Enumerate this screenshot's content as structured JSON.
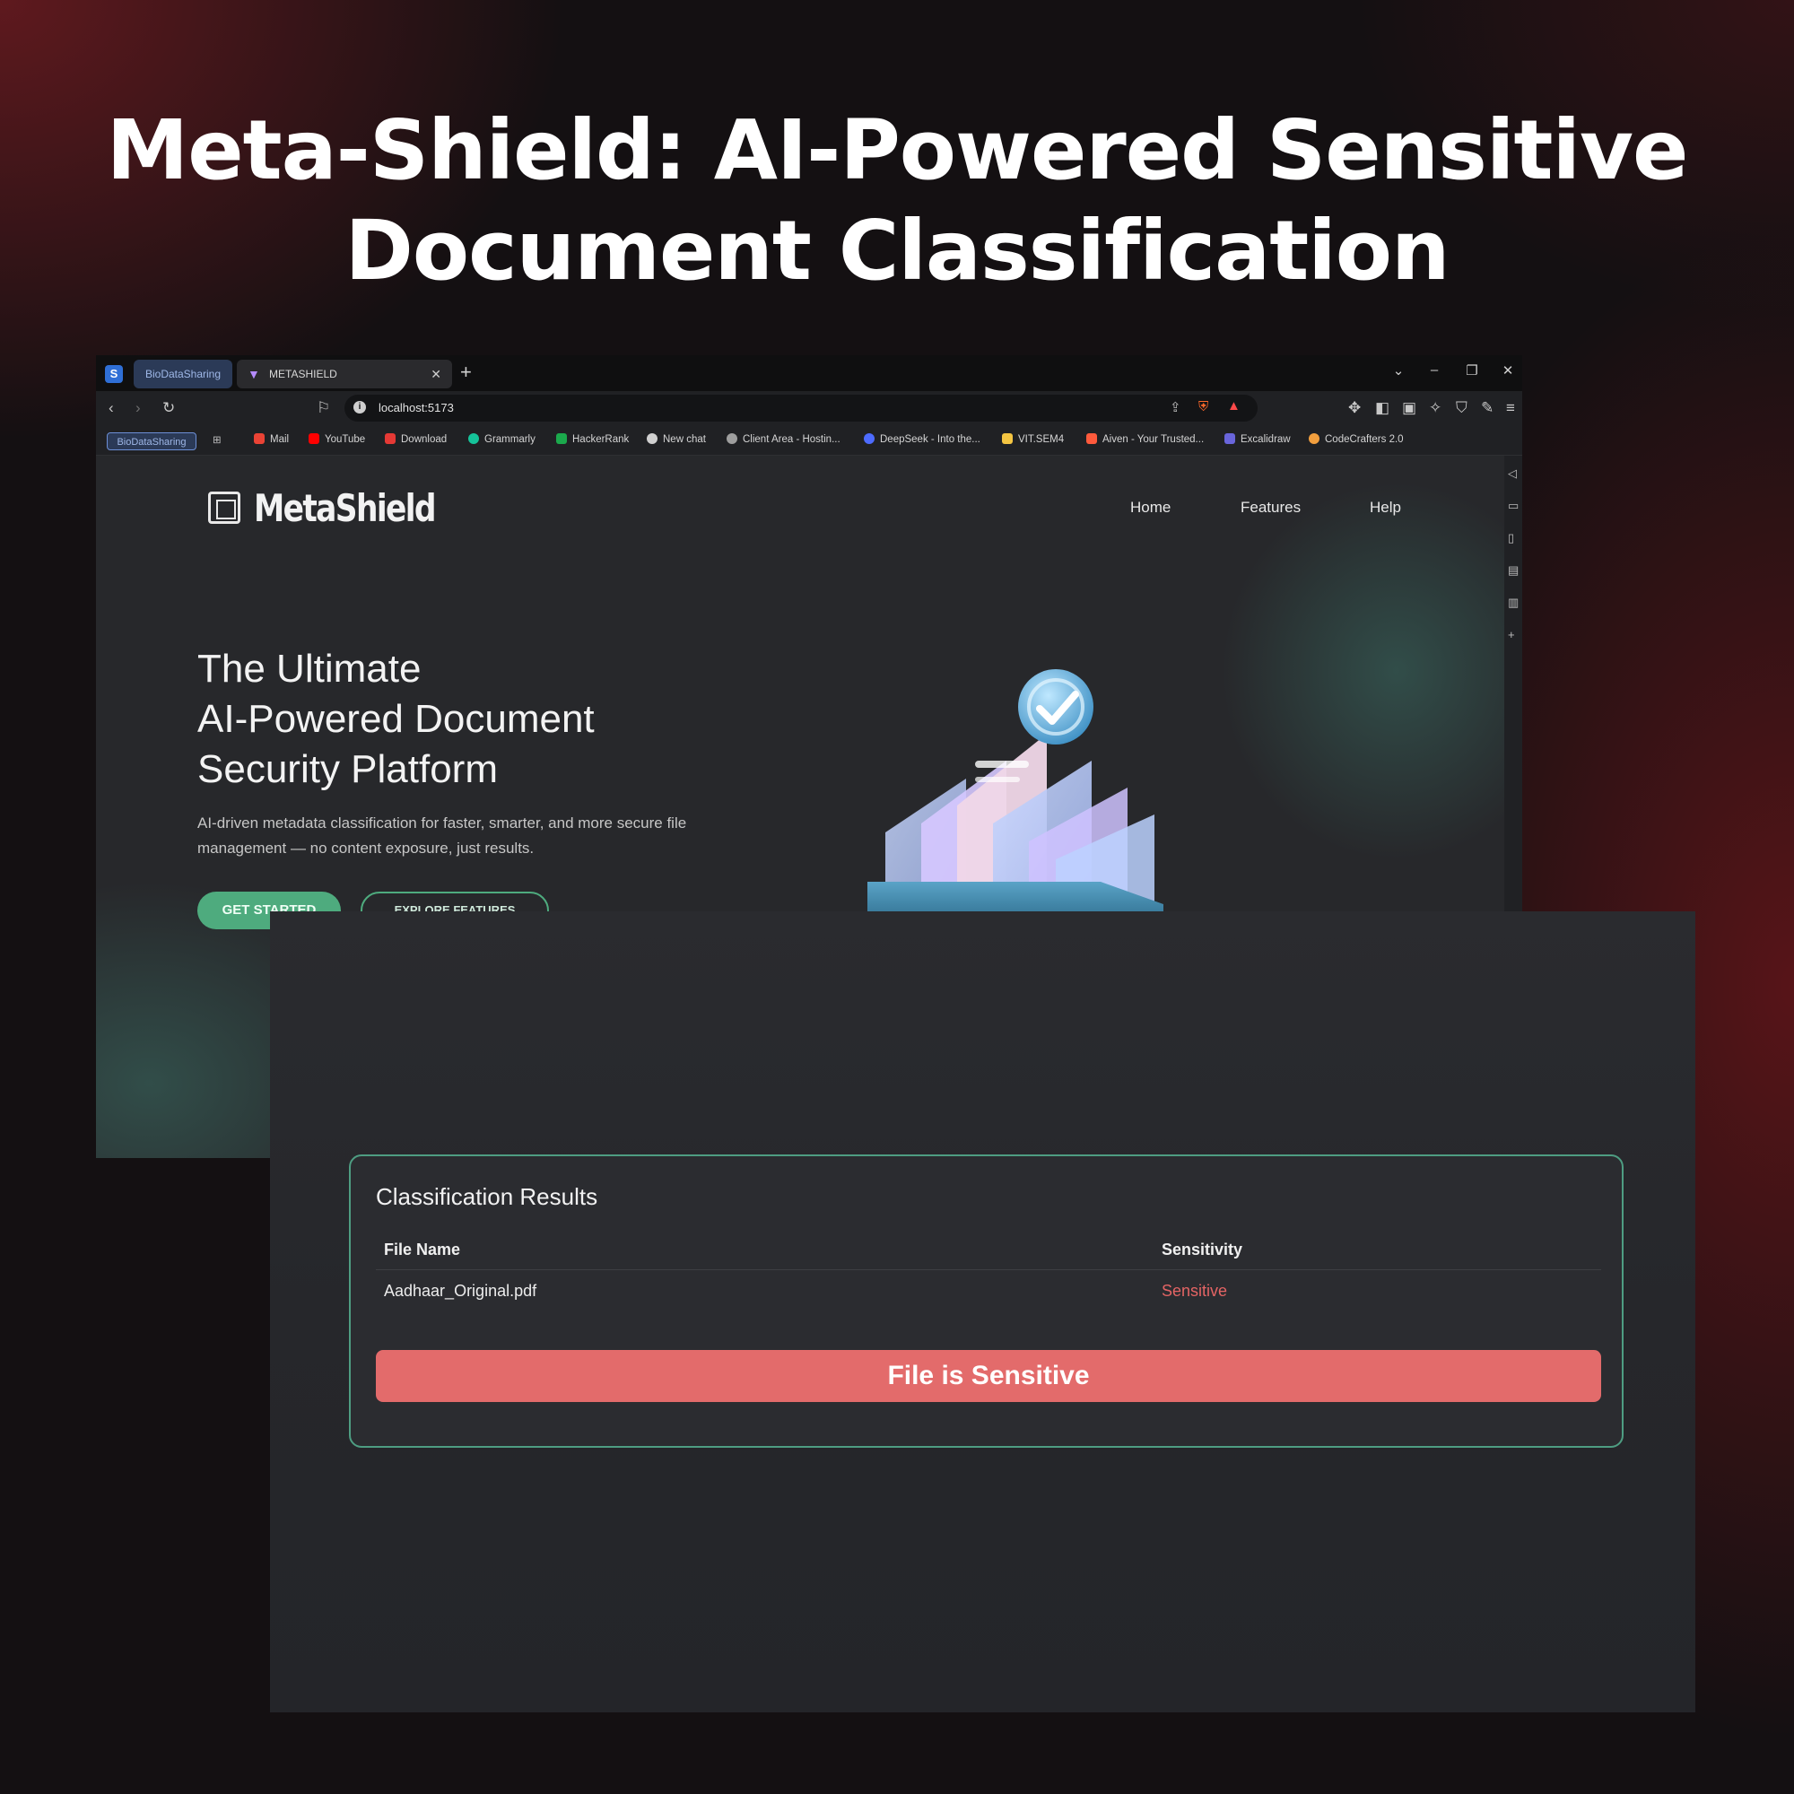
{
  "headline": {
    "line1": "Meta-Shield: AI-Powered Sensitive",
    "line2": "Document Classification"
  },
  "browser": {
    "tab_group_label": "BioDataSharing",
    "active_tab_title": "METASHIELD",
    "url": "localhost:5173",
    "bookmarks_group_label": "BioDataSharing",
    "bookmarks": [
      {
        "label": "Mail",
        "color": "#ea4335"
      },
      {
        "label": "YouTube",
        "color": "#ff0000"
      },
      {
        "label": "Download",
        "color": "#e53935"
      },
      {
        "label": "Grammarly",
        "color": "#15c39a"
      },
      {
        "label": "HackerRank",
        "color": "#1ba94c"
      },
      {
        "label": "New chat",
        "color": "#d0d0d0"
      },
      {
        "label": "Client Area - Hostin...",
        "color": "#9e9e9e"
      },
      {
        "label": "DeepSeek - Into the...",
        "color": "#4d6bfe"
      },
      {
        "label": "VIT.SEM4",
        "color": "#f4c542"
      },
      {
        "label": "Aiven - Your Trusted...",
        "color": "#ff5a3c"
      },
      {
        "label": "Excalidraw",
        "color": "#6965db"
      },
      {
        "label": "CodeCrafters 2.0",
        "color": "#f29f3e"
      }
    ]
  },
  "site": {
    "logo_text": "MetaShield",
    "nav": [
      "Home",
      "Features",
      "Help"
    ],
    "hero_title": [
      "The Ultimate",
      "AI-Powered Document",
      "Security Platform"
    ],
    "hero_subtitle": "AI-driven metadata classification for faster, smarter, and more secure file management — no content exposure, just results.",
    "cta_primary": "GET STARTED",
    "cta_secondary": "EXPLORE FEATURES"
  },
  "results": {
    "title": "Classification Results",
    "columns": [
      "File Name",
      "Sensitivity"
    ],
    "rows": [
      {
        "file_name": "Aadhaar_Original.pdf",
        "sensitivity": "Sensitive"
      }
    ],
    "alert": "File is Sensitive"
  },
  "colors": {
    "accent_green": "#4eab7e",
    "alert_red": "#e36b6b",
    "sensitive_text": "#e46464"
  }
}
